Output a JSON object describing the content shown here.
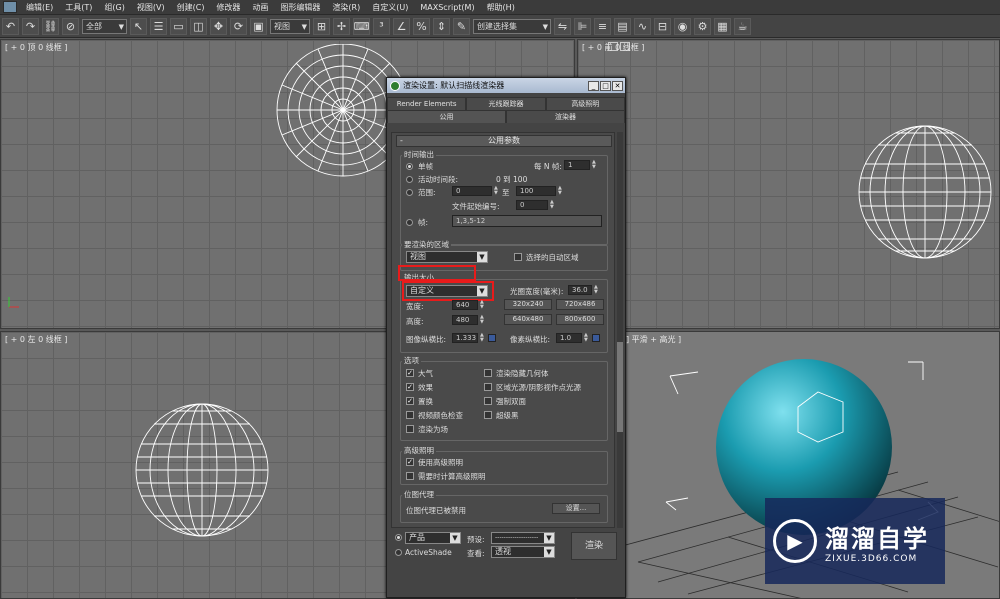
{
  "menubar": {
    "items": [
      "编辑(E)",
      "工具(T)",
      "组(G)",
      "视图(V)",
      "创建(C)",
      "修改器",
      "动画",
      "图形编辑器",
      "渲染(R)",
      "自定义(U)",
      "MAXScript(M)",
      "帮助(H)"
    ]
  },
  "toolbar": {
    "filter_value": "全部",
    "view_value": "视图",
    "selection_set_value": "创建选择集"
  },
  "viewports": {
    "top": "[ + 0 顶 0 线框 ]",
    "front": "[ + 0 前 0 线框 ]",
    "left": "[ + 0 左 0 线框 ]",
    "perspective": "[ + 0 透视 0 平滑 + 高光 ]",
    "perspective_visible": "] 平滑 + 高光 ]"
  },
  "dialog": {
    "title": "渲染设置: 默认扫描线渲染器",
    "tabs_row1": [
      "Render Elements",
      "光线跟踪器",
      "高级照明"
    ],
    "tabs_row2": [
      "公用",
      "渲染器"
    ],
    "active_tab": "公用",
    "rollout_title": "公用参数",
    "time_output": {
      "group": "时间输出",
      "single": "单帧",
      "every_n": "每 N 帧:",
      "every_n_value": "1",
      "active_segment": "活动时间段:",
      "active_range": "0 到 100",
      "range": "范围:",
      "range_from": "0",
      "range_to_label": "至",
      "range_to": "100",
      "file_number_base": "文件起始编号:",
      "file_number_value": "0",
      "frames": "帧:",
      "frames_value": "1,3,5-12"
    },
    "area": {
      "group": "要渲染的区域",
      "value": "视图",
      "auto_region": "选择的自动区域"
    },
    "output_size": {
      "group": "输出大小",
      "preset": "自定义",
      "aperture_label": "光圈宽度(毫米):",
      "aperture_value": "36.0",
      "width_label": "宽度:",
      "width_value": "640",
      "height_label": "高度:",
      "height_value": "480",
      "presets": [
        "320x240",
        "720x486",
        "640x480",
        "800x600"
      ],
      "image_aspect_label": "图像纵横比:",
      "image_aspect_value": "1.333",
      "pixel_aspect_label": "像素纵横比:",
      "pixel_aspect_value": "1.0"
    },
    "options": {
      "group": "选项",
      "left": [
        {
          "label": "大气",
          "checked": true
        },
        {
          "label": "效果",
          "checked": true
        },
        {
          "label": "置换",
          "checked": true
        },
        {
          "label": "视频颜色检查",
          "checked": false
        },
        {
          "label": "渲染为场",
          "checked": false
        }
      ],
      "right": [
        {
          "label": "渲染隐藏几何体",
          "checked": false
        },
        {
          "label": "区域光源/阴影视作点光源",
          "checked": false
        },
        {
          "label": "强制双面",
          "checked": false
        },
        {
          "label": "超级黑",
          "checked": false
        }
      ]
    },
    "advanced_lighting": {
      "group": "高级照明",
      "use": "使用高级照明",
      "compute": "需要时计算高级照明"
    },
    "bitmap_proxy": {
      "group": "位图代理",
      "status": "位图代理已被禁用",
      "button": "设置..."
    },
    "bottom": {
      "product": "产品",
      "preset_label": "预设:",
      "preset_value": "--------------------",
      "activeshade": "ActiveShade",
      "view_label": "查看:",
      "view_value": "透视",
      "render_button": "渲染"
    }
  },
  "watermark": {
    "title": "溜溜自学",
    "url": "ZIXUE.3D66.COM"
  }
}
